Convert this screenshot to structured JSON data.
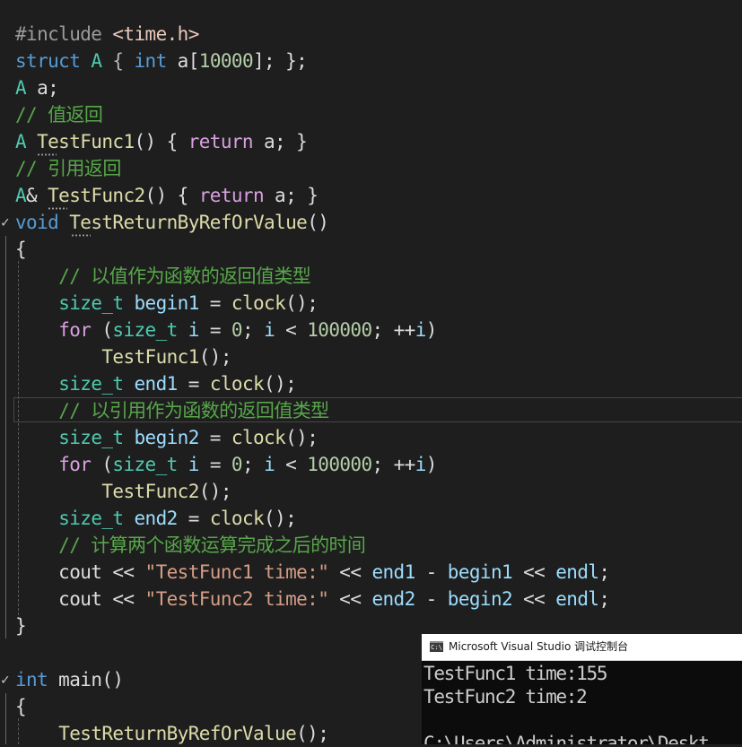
{
  "editor": {
    "lines": [
      [
        [
          "#include ",
          "inc"
        ],
        [
          "<time.h>",
          "incstr"
        ]
      ],
      [
        [
          "struct",
          "kw"
        ],
        [
          " "
        ],
        [
          "A",
          "typ"
        ],
        [
          " { ",
          "punc"
        ],
        [
          "int",
          "kw"
        ],
        [
          " a["
        ],
        [
          "10000",
          "num"
        ],
        [
          "]; };"
        ]
      ],
      [
        [
          "A",
          "typ"
        ],
        [
          " a;"
        ]
      ],
      [
        [
          "// 值返回",
          "cmt"
        ]
      ],
      [
        [
          "A",
          "typ"
        ],
        [
          " "
        ],
        [
          "TestFunc1",
          "fn"
        ],
        [
          "() { "
        ],
        [
          "return",
          "ctl"
        ],
        [
          " a; }"
        ]
      ],
      [
        [
          "// 引用返回",
          "cmt"
        ]
      ],
      [
        [
          "A",
          "typ"
        ],
        [
          "& "
        ],
        [
          "TestFunc2",
          "fn"
        ],
        [
          "() { "
        ],
        [
          "return",
          "ctl"
        ],
        [
          " a; }"
        ]
      ],
      [
        [
          "void",
          "kw"
        ],
        [
          " "
        ],
        [
          "TestReturnByRefOrValue",
          "fn"
        ],
        [
          "()"
        ]
      ],
      [
        [
          "{"
        ]
      ],
      [
        [
          "    "
        ],
        [
          "// 以值作为函数的返回值类型",
          "cmt"
        ]
      ],
      [
        [
          "    "
        ],
        [
          "size_t",
          "typ"
        ],
        [
          " "
        ],
        [
          "begin1",
          "var"
        ],
        [
          " = "
        ],
        [
          "clock",
          "fn"
        ],
        [
          "();"
        ]
      ],
      [
        [
          "    "
        ],
        [
          "for",
          "ctl"
        ],
        [
          " ("
        ],
        [
          "size_t",
          "typ"
        ],
        [
          " "
        ],
        [
          "i",
          "var"
        ],
        [
          " = "
        ],
        [
          "0",
          "num"
        ],
        [
          "; "
        ],
        [
          "i",
          "var"
        ],
        [
          " < "
        ],
        [
          "100000",
          "num"
        ],
        [
          "; ++"
        ],
        [
          "i",
          "var"
        ],
        [
          ")"
        ]
      ],
      [
        [
          "        "
        ],
        [
          "TestFunc1",
          "fn"
        ],
        [
          "();"
        ]
      ],
      [
        [
          "    "
        ],
        [
          "size_t",
          "typ"
        ],
        [
          " "
        ],
        [
          "end1",
          "var"
        ],
        [
          " = "
        ],
        [
          "clock",
          "fn"
        ],
        [
          "();"
        ]
      ],
      [
        [
          "    "
        ],
        [
          "// 以引用作为函数的返回值类型",
          "cmt"
        ]
      ],
      [
        [
          "    "
        ],
        [
          "size_t",
          "typ"
        ],
        [
          " "
        ],
        [
          "begin2",
          "var"
        ],
        [
          " = "
        ],
        [
          "clock",
          "fn"
        ],
        [
          "();"
        ]
      ],
      [
        [
          "    "
        ],
        [
          "for",
          "ctl"
        ],
        [
          " ("
        ],
        [
          "size_t",
          "typ"
        ],
        [
          " "
        ],
        [
          "i",
          "var"
        ],
        [
          " = "
        ],
        [
          "0",
          "num"
        ],
        [
          "; "
        ],
        [
          "i",
          "var"
        ],
        [
          " < "
        ],
        [
          "100000",
          "num"
        ],
        [
          "; ++"
        ],
        [
          "i",
          "var"
        ],
        [
          ")"
        ]
      ],
      [
        [
          "        "
        ],
        [
          "TestFunc2",
          "fn"
        ],
        [
          "();"
        ]
      ],
      [
        [
          "    "
        ],
        [
          "size_t",
          "typ"
        ],
        [
          " "
        ],
        [
          "end2",
          "var"
        ],
        [
          " = "
        ],
        [
          "clock",
          "fn"
        ],
        [
          "();"
        ]
      ],
      [
        [
          "    "
        ],
        [
          "// 计算两个函数运算完成之后的时间",
          "cmt"
        ]
      ],
      [
        [
          "    cout << "
        ],
        [
          "\"TestFunc1 time:\"",
          "str"
        ],
        [
          " << "
        ],
        [
          "end1",
          "var"
        ],
        [
          " - "
        ],
        [
          "begin1",
          "var"
        ],
        [
          " << "
        ],
        [
          "endl",
          "var"
        ],
        [
          ";"
        ]
      ],
      [
        [
          "    cout << "
        ],
        [
          "\"TestFunc2 time:\"",
          "str"
        ],
        [
          " << "
        ],
        [
          "end2",
          "var"
        ],
        [
          " - "
        ],
        [
          "begin2",
          "var"
        ],
        [
          " << "
        ],
        [
          "endl",
          "var"
        ],
        [
          ";"
        ]
      ],
      [
        [
          "}"
        ]
      ],
      [
        [
          ""
        ]
      ],
      [
        [
          "int",
          "kw"
        ],
        [
          " main()"
        ]
      ],
      [
        [
          "{"
        ]
      ],
      [
        [
          "    "
        ],
        [
          "TestReturnByRefOrValue",
          "fn"
        ],
        [
          "();"
        ]
      ]
    ],
    "fold_markers": [
      {
        "line": 7,
        "glyph": "✓"
      },
      {
        "line": 24,
        "glyph": "✓"
      }
    ]
  },
  "console": {
    "icon": "console-window-icon",
    "icon_text": "C:\\",
    "title": "Microsoft Visual Studio 调试控制台",
    "output_lines": [
      "TestFunc1 time:155",
      "TestFunc2 time:2",
      "",
      "C:\\Users\\Administrator\\Deskt"
    ]
  }
}
